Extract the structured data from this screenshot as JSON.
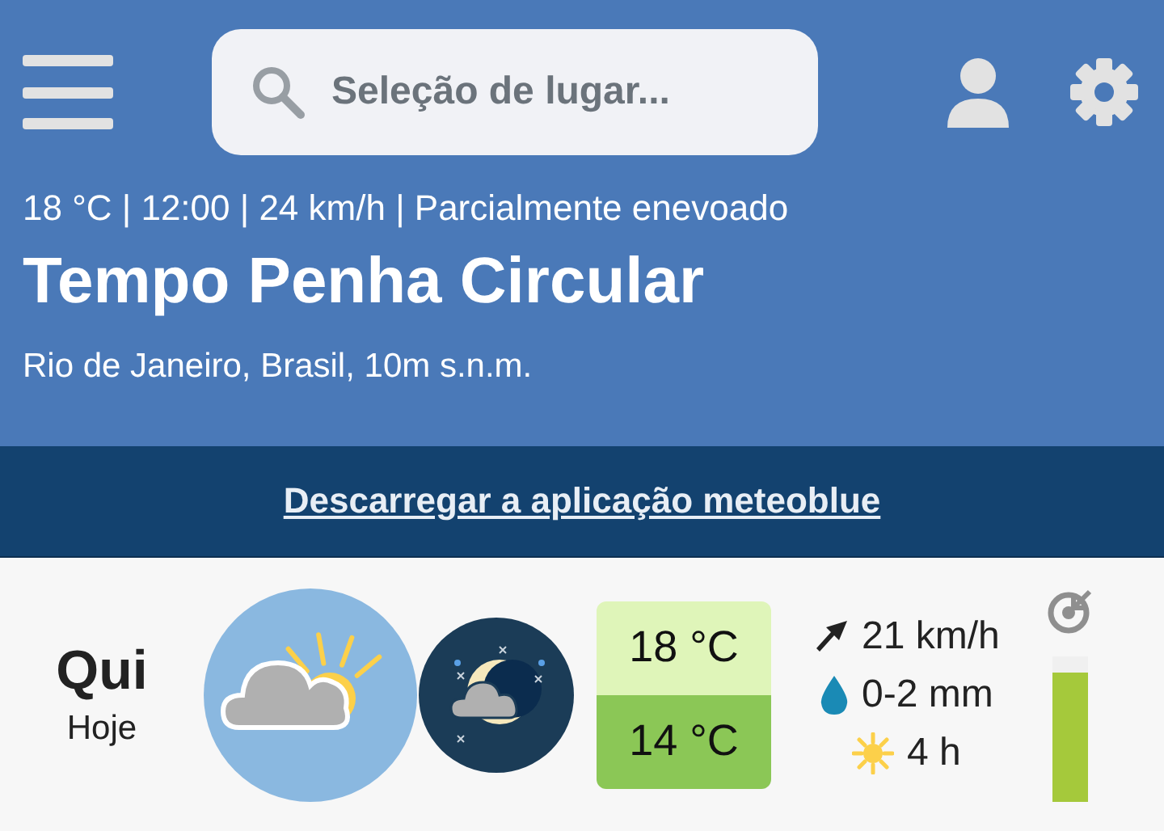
{
  "header": {
    "search": {
      "placeholder": "Seleção de lugar..."
    },
    "current": "18 °C | 12:00 | 24 km/h | Parcialmente enevoado",
    "title": "Tempo Penha Circular",
    "location": "Rio de Janeiro, Brasil, 10m s.n.m."
  },
  "banner": {
    "link": "Descarregar a aplicação meteoblue"
  },
  "day": {
    "weekday": "Qui",
    "label": "Hoje",
    "temp_max": "18 °C",
    "temp_min": "14 °C",
    "wind": "21 km/h",
    "precipitation": "0-2 mm",
    "sunshine": "4 h",
    "predictability": {
      "level": 0.88
    }
  }
}
